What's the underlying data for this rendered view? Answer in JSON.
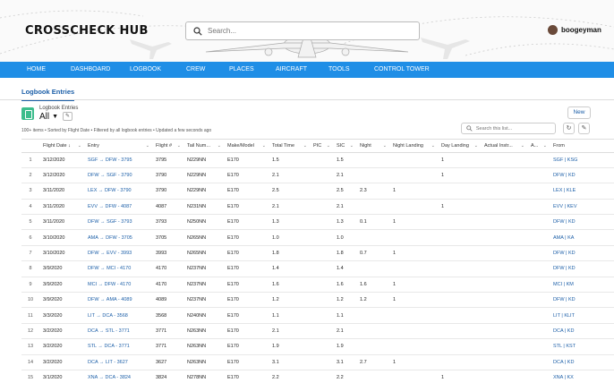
{
  "app": {
    "logo": "CROSSCHECK HUB",
    "search_placeholder": "Search...",
    "username": "boogeyman"
  },
  "nav": [
    {
      "label": "HOME"
    },
    {
      "label": "DASHBOARD"
    },
    {
      "label": "LOGBOOK"
    },
    {
      "label": "CREW"
    },
    {
      "label": "PLACES"
    },
    {
      "label": "AIRCRAFT"
    },
    {
      "label": "TOOLS"
    },
    {
      "label": "CONTROL TOWER"
    }
  ],
  "subtab": "Logbook Entries",
  "list_header": {
    "title": "Logbook Entries",
    "view": "All",
    "new_label": "New",
    "meta": "100+ items • Sorted by Flight Date • Filtered by all logbook entries • Updated a few seconds ago",
    "search_placeholder": "Search this list..."
  },
  "columns": [
    "",
    "Flight Date ↓",
    "Entry",
    "Flight #",
    "Tail Num...",
    "Make/Model",
    "Total Time",
    "PIC",
    "SIC",
    "Night",
    "Night Landing",
    "Day Landing",
    "Actual Instr...",
    "A...",
    "From"
  ],
  "rows": [
    [
      "1",
      "3/12/2020",
      "SGF → DFW - 3795",
      "3795",
      "N229NN",
      "E170",
      "1.5",
      "",
      "1.5",
      "",
      "",
      "1",
      "",
      "",
      "SGF | KSG"
    ],
    [
      "2",
      "3/12/2020",
      "DFW → SGF - 3790",
      "3790",
      "N229NN",
      "E170",
      "2.1",
      "",
      "2.1",
      "",
      "",
      "1",
      "",
      "",
      "DFW | KD"
    ],
    [
      "3",
      "3/11/2020",
      "LEX → DFW - 3790",
      "3790",
      "N229NN",
      "E170",
      "2.5",
      "",
      "2.5",
      "2.3",
      "1",
      "",
      "",
      "",
      "LEX | KLE"
    ],
    [
      "4",
      "3/11/2020",
      "EVV → DFW - 4087",
      "4087",
      "N231NN",
      "E170",
      "2.1",
      "",
      "2.1",
      "",
      "",
      "1",
      "",
      "",
      "EVV | KEV"
    ],
    [
      "5",
      "3/11/2020",
      "DFW → SGF - 3793",
      "3793",
      "N250NN",
      "E170",
      "1.3",
      "",
      "1.3",
      "0.1",
      "1",
      "",
      "",
      "",
      "DFW | KD"
    ],
    [
      "6",
      "3/10/2020",
      "AMA → DFW - 3705",
      "3705",
      "N265NN",
      "E170",
      "1.0",
      "",
      "1.0",
      "",
      "",
      "",
      "",
      "",
      "AMA | KA"
    ],
    [
      "7",
      "3/10/2020",
      "DFW → EVV - 3993",
      "3993",
      "N265NN",
      "E170",
      "1.8",
      "",
      "1.8",
      "0.7",
      "1",
      "",
      "",
      "",
      "DFW | KD"
    ],
    [
      "8",
      "3/9/2020",
      "DFW → MCI - 4170",
      "4170",
      "N237NN",
      "E170",
      "1.4",
      "",
      "1.4",
      "",
      "",
      "",
      "",
      "",
      "DFW | KD"
    ],
    [
      "9",
      "3/9/2020",
      "MCI → DFW - 4170",
      "4170",
      "N237NN",
      "E170",
      "1.6",
      "",
      "1.6",
      "1.6",
      "1",
      "",
      "",
      "",
      "MCI | KM"
    ],
    [
      "10",
      "3/9/2020",
      "DFW → AMA - 4089",
      "4089",
      "N237NN",
      "E170",
      "1.2",
      "",
      "1.2",
      "1.2",
      "1",
      "",
      "",
      "",
      "DFW | KD"
    ],
    [
      "11",
      "3/3/2020",
      "LIT → DCA - 3568",
      "3568",
      "N240NN",
      "E170",
      "1.1",
      "",
      "1.1",
      "",
      "",
      "",
      "",
      "",
      "LIT | KLIT"
    ],
    [
      "12",
      "3/2/2020",
      "DCA → STL - 3771",
      "3771",
      "N263NN",
      "E170",
      "2.1",
      "",
      "2.1",
      "",
      "",
      "",
      "",
      "",
      "DCA | KD"
    ],
    [
      "13",
      "3/2/2020",
      "STL → DCA - 3771",
      "3771",
      "N263NN",
      "E170",
      "1.9",
      "",
      "1.9",
      "",
      "",
      "",
      "",
      "",
      "STL | KST"
    ],
    [
      "14",
      "3/2/2020",
      "DCA → LIT - 3627",
      "3627",
      "N263NN",
      "E170",
      "3.1",
      "",
      "3.1",
      "2.7",
      "1",
      "",
      "",
      "",
      "DCA | KD"
    ],
    [
      "15",
      "3/1/2020",
      "XNA → DCA - 3824",
      "3824",
      "N278NN",
      "E170",
      "2.2",
      "",
      "2.2",
      "",
      "",
      "1",
      "",
      "",
      "XNA | KX"
    ]
  ],
  "colors": {
    "nav_bg": "#1f8ee6",
    "link": "#1c5fa8",
    "list_icon": "#3dbd8c"
  }
}
